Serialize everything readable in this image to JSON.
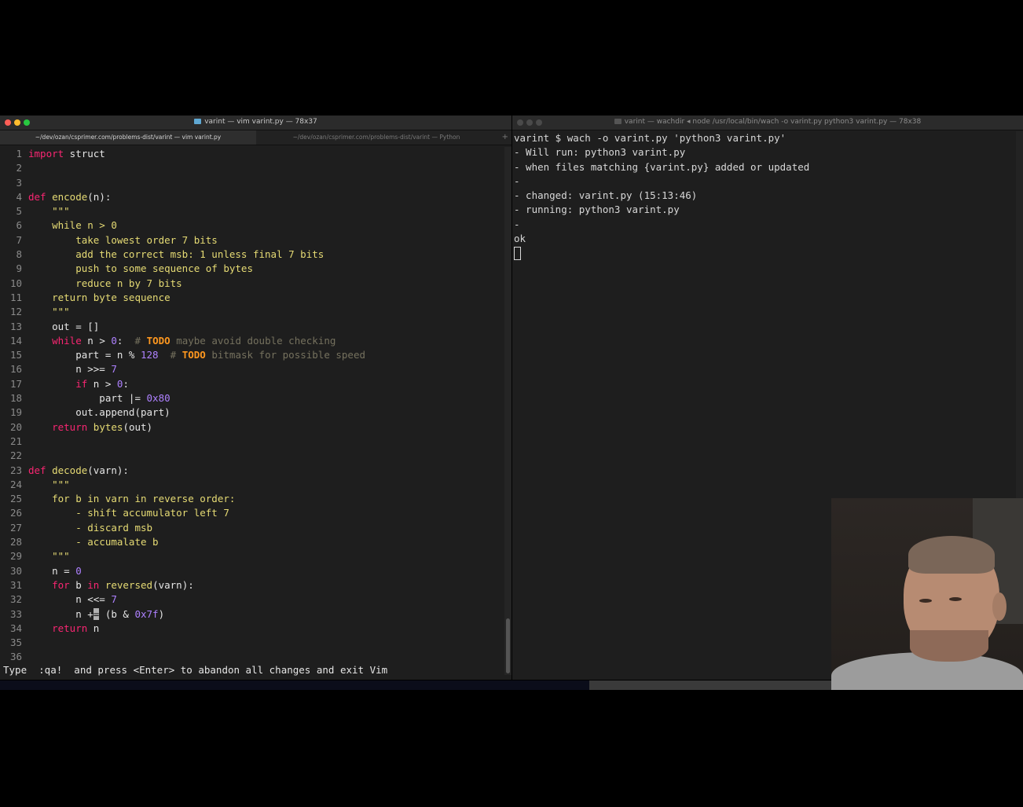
{
  "left_window": {
    "title": "varint — vim varint.py — 78x37",
    "tabs": [
      {
        "label": "~/dev/ozan/csprimer.com/problems-dist/varint — vim varint.py",
        "active": true
      },
      {
        "label": "~/dev/ozan/csprimer.com/problems-dist/varint — Python",
        "active": false
      }
    ],
    "add_tab": "+",
    "code": [
      [
        [
          "kw",
          "import"
        ],
        [
          "plain",
          " struct"
        ]
      ],
      [],
      [],
      [
        [
          "kw",
          "def"
        ],
        [
          "plain",
          " "
        ],
        [
          "fn",
          "encode"
        ],
        [
          "plain",
          "(n):"
        ]
      ],
      [
        [
          "str",
          "    \"\"\""
        ]
      ],
      [
        [
          "str",
          "    while n > 0"
        ]
      ],
      [
        [
          "str",
          "        take lowest order 7 bits"
        ]
      ],
      [
        [
          "str",
          "        add the correct msb: 1 unless final 7 bits"
        ]
      ],
      [
        [
          "str",
          "        push to some sequence of bytes"
        ]
      ],
      [
        [
          "str",
          "        reduce n by 7 bits"
        ]
      ],
      [
        [
          "str",
          "    return byte sequence"
        ]
      ],
      [
        [
          "str",
          "    \"\"\""
        ]
      ],
      [
        [
          "plain",
          "    out = []"
        ]
      ],
      [
        [
          "plain",
          "    "
        ],
        [
          "kw",
          "while"
        ],
        [
          "plain",
          " n > "
        ],
        [
          "num",
          "0"
        ],
        [
          "plain",
          ":  "
        ],
        [
          "com",
          "# "
        ],
        [
          "todo",
          "TODO"
        ],
        [
          "com",
          " maybe avoid double checking"
        ]
      ],
      [
        [
          "plain",
          "        part = n % "
        ],
        [
          "num",
          "128"
        ],
        [
          "plain",
          "  "
        ],
        [
          "com",
          "# "
        ],
        [
          "todo",
          "TODO"
        ],
        [
          "com",
          " bitmask for possible speed"
        ]
      ],
      [
        [
          "plain",
          "        n >>= "
        ],
        [
          "num",
          "7"
        ]
      ],
      [
        [
          "plain",
          "        "
        ],
        [
          "kw",
          "if"
        ],
        [
          "plain",
          " n > "
        ],
        [
          "num",
          "0"
        ],
        [
          "plain",
          ":"
        ]
      ],
      [
        [
          "plain",
          "            part |= "
        ],
        [
          "num",
          "0x80"
        ]
      ],
      [
        [
          "plain",
          "        out.append(part)"
        ]
      ],
      [
        [
          "plain",
          "    "
        ],
        [
          "kw",
          "return"
        ],
        [
          "plain",
          " "
        ],
        [
          "fn",
          "bytes"
        ],
        [
          "plain",
          "(out)"
        ]
      ],
      [],
      [],
      [
        [
          "kw",
          "def"
        ],
        [
          "plain",
          " "
        ],
        [
          "fn",
          "decode"
        ],
        [
          "plain",
          "(varn):"
        ]
      ],
      [
        [
          "str",
          "    \"\"\""
        ]
      ],
      [
        [
          "str",
          "    for b in varn in reverse order:"
        ]
      ],
      [
        [
          "str",
          "        - shift accumulator left 7"
        ]
      ],
      [
        [
          "str",
          "        - discard msb"
        ]
      ],
      [
        [
          "str",
          "        - accumalate b"
        ]
      ],
      [
        [
          "str",
          "    \"\"\""
        ]
      ],
      [
        [
          "plain",
          "    n = "
        ],
        [
          "num",
          "0"
        ]
      ],
      [
        [
          "plain",
          "    "
        ],
        [
          "kw",
          "for"
        ],
        [
          "plain",
          " b "
        ],
        [
          "kw",
          "in"
        ],
        [
          "plain",
          " "
        ],
        [
          "fn",
          "reversed"
        ],
        [
          "plain",
          "(varn):"
        ]
      ],
      [
        [
          "plain",
          "        n <<= "
        ],
        [
          "num",
          "7"
        ]
      ],
      [
        [
          "plain",
          "        n +"
        ],
        [
          "cursor",
          "="
        ],
        [
          "plain",
          " (b & "
        ],
        [
          "num",
          "0x7f"
        ],
        [
          "plain",
          ")"
        ]
      ],
      [
        [
          "plain",
          "    "
        ],
        [
          "kw",
          "return"
        ],
        [
          "plain",
          " n"
        ]
      ],
      [],
      []
    ],
    "command_line": "Type  :qa!  and press <Enter> to abandon all changes and exit Vim"
  },
  "right_window": {
    "title": "varint — wachdir ◂ node /usr/local/bin/wach -o varint.py python3 varint.py — 78x38",
    "terminal_lines": [
      "varint $ wach -o varint.py 'python3 varint.py'",
      "- Will run: python3 varint.py",
      "- when files matching {varint.py} added or updated",
      "-",
      "- changed: varint.py (15:13:46)",
      "- running: python3 varint.py",
      "-",
      "ok"
    ]
  },
  "colors": {
    "keyword": "#f92672",
    "function": "#e6db74",
    "string": "#e6db74",
    "number": "#ae81ff",
    "comment": "#75715e",
    "todo": "#fd971f",
    "text": "#e6e6e6"
  }
}
